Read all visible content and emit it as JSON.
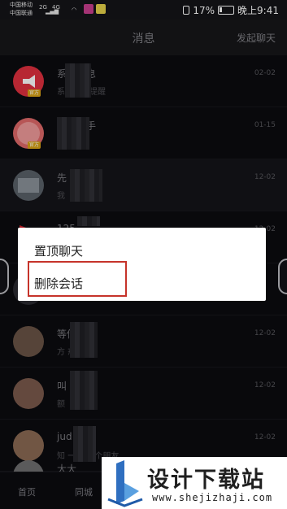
{
  "status_bar": {
    "carrier_1": "中国移动",
    "carrier_2": "中国联通",
    "signal_1": "2G",
    "signal_2": "4G",
    "battery": "17%",
    "time": "晚上9:41"
  },
  "header": {
    "title": "消息",
    "action": "发起聊天"
  },
  "chats": [
    {
      "name": "系统消息",
      "preview": "系统中心提醒",
      "time": "02-02",
      "badge": "官方",
      "avatar_color": "#e0303f"
    },
    {
      "name": "活动助手",
      "preview": "",
      "time": "01-15",
      "badge": "官方",
      "avatar_color": "#e06a6a"
    },
    {
      "name": "先",
      "preview": "我",
      "time": "12-02",
      "badge": "",
      "avatar_color": "#5a6168"
    },
    {
      "name": "125",
      "preview": "",
      "time": "12-02",
      "badge": "",
      "avatar_color": "#d0202a"
    },
    {
      "name": "",
      "preview": "",
      "time": "",
      "badge": "",
      "avatar_color": "#2a2a30"
    },
    {
      "name": "等你",
      "preview": "方 戒信么",
      "time": "12-02",
      "badge": "",
      "avatar_color": "#6a5446"
    },
    {
      "name": "叫",
      "preview": "额",
      "time": "12-02",
      "badge": "",
      "avatar_color": "#7a5a4c"
    },
    {
      "name": "jud",
      "preview": "知 一下 交个朋友",
      "time": "12-02",
      "badge": "",
      "avatar_color": "#8a6a54"
    },
    {
      "name": "大大",
      "preview": "",
      "time": "",
      "badge": "",
      "avatar_color": "#6e6e70"
    }
  ],
  "context_menu": {
    "items": [
      "置顶聊天",
      "删除会话"
    ],
    "highlight_color": "#c6332a"
  },
  "tabs": [
    "首页",
    "同城"
  ],
  "watermark": {
    "title": "设计下载站",
    "url": "www.shejizhaji.com"
  }
}
